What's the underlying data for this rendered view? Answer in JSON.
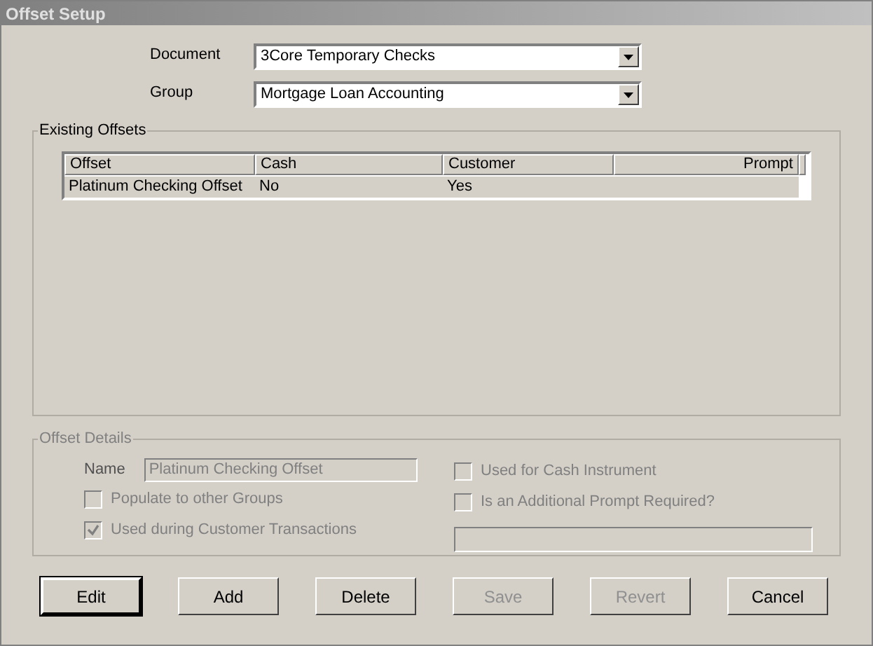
{
  "window": {
    "title": "Offset Setup"
  },
  "selectors": [
    {
      "label": "Document",
      "value": "3Core Temporary Checks"
    },
    {
      "label": "Group",
      "value": "Mortgage Loan Accounting"
    }
  ],
  "existing_offsets": {
    "title": "Existing Offsets",
    "columns": [
      "Offset",
      "Cash",
      "Customer",
      "Prompt"
    ],
    "rows": [
      {
        "cells": [
          "Platinum Checking Offset",
          "No",
          "Yes",
          ""
        ],
        "selected": true
      }
    ]
  },
  "offset_details": {
    "title": "Offset Details",
    "name_label": "Name",
    "name_value": "Platinum Checking Offset",
    "name_disabled": true,
    "left_checkboxes": [
      {
        "label": "Populate to other Groups",
        "checked": false,
        "disabled": true
      },
      {
        "label": "Used during Customer Transactions",
        "checked": true,
        "disabled": true
      }
    ],
    "right_checkboxes": [
      {
        "label": "Used for Cash Instrument",
        "checked": false,
        "disabled": true
      },
      {
        "label": "Is an Additional Prompt Required?",
        "checked": false,
        "disabled": true
      }
    ],
    "prompt_field_disabled": true
  },
  "buttons": [
    {
      "label": "Edit",
      "disabled": false,
      "default": true
    },
    {
      "label": "Add",
      "disabled": false,
      "default": false
    },
    {
      "label": "Delete",
      "disabled": false,
      "default": false
    },
    {
      "label": "Save",
      "disabled": true,
      "default": false
    },
    {
      "label": "Revert",
      "disabled": true,
      "default": false
    },
    {
      "label": "Cancel",
      "disabled": false,
      "default": false
    }
  ]
}
